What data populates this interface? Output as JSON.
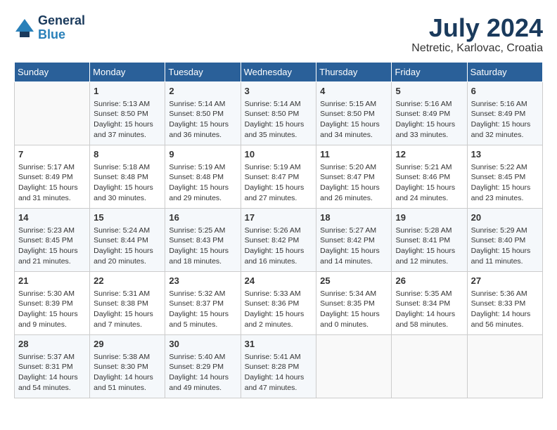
{
  "logo": {
    "line1": "General",
    "line2": "Blue"
  },
  "title": "July 2024",
  "location": "Netretic, Karlovac, Croatia",
  "headers": [
    "Sunday",
    "Monday",
    "Tuesday",
    "Wednesday",
    "Thursday",
    "Friday",
    "Saturday"
  ],
  "weeks": [
    [
      {
        "day": "",
        "data": ""
      },
      {
        "day": "1",
        "data": "Sunrise: 5:13 AM\nSunset: 8:50 PM\nDaylight: 15 hours and 37 minutes."
      },
      {
        "day": "2",
        "data": "Sunrise: 5:14 AM\nSunset: 8:50 PM\nDaylight: 15 hours and 36 minutes."
      },
      {
        "day": "3",
        "data": "Sunrise: 5:14 AM\nSunset: 8:50 PM\nDaylight: 15 hours and 35 minutes."
      },
      {
        "day": "4",
        "data": "Sunrise: 5:15 AM\nSunset: 8:50 PM\nDaylight: 15 hours and 34 minutes."
      },
      {
        "day": "5",
        "data": "Sunrise: 5:16 AM\nSunset: 8:49 PM\nDaylight: 15 hours and 33 minutes."
      },
      {
        "day": "6",
        "data": "Sunrise: 5:16 AM\nSunset: 8:49 PM\nDaylight: 15 hours and 32 minutes."
      }
    ],
    [
      {
        "day": "7",
        "data": "Sunrise: 5:17 AM\nSunset: 8:49 PM\nDaylight: 15 hours and 31 minutes."
      },
      {
        "day": "8",
        "data": "Sunrise: 5:18 AM\nSunset: 8:48 PM\nDaylight: 15 hours and 30 minutes."
      },
      {
        "day": "9",
        "data": "Sunrise: 5:19 AM\nSunset: 8:48 PM\nDaylight: 15 hours and 29 minutes."
      },
      {
        "day": "10",
        "data": "Sunrise: 5:19 AM\nSunset: 8:47 PM\nDaylight: 15 hours and 27 minutes."
      },
      {
        "day": "11",
        "data": "Sunrise: 5:20 AM\nSunset: 8:47 PM\nDaylight: 15 hours and 26 minutes."
      },
      {
        "day": "12",
        "data": "Sunrise: 5:21 AM\nSunset: 8:46 PM\nDaylight: 15 hours and 24 minutes."
      },
      {
        "day": "13",
        "data": "Sunrise: 5:22 AM\nSunset: 8:45 PM\nDaylight: 15 hours and 23 minutes."
      }
    ],
    [
      {
        "day": "14",
        "data": "Sunrise: 5:23 AM\nSunset: 8:45 PM\nDaylight: 15 hours and 21 minutes."
      },
      {
        "day": "15",
        "data": "Sunrise: 5:24 AM\nSunset: 8:44 PM\nDaylight: 15 hours and 20 minutes."
      },
      {
        "day": "16",
        "data": "Sunrise: 5:25 AM\nSunset: 8:43 PM\nDaylight: 15 hours and 18 minutes."
      },
      {
        "day": "17",
        "data": "Sunrise: 5:26 AM\nSunset: 8:42 PM\nDaylight: 15 hours and 16 minutes."
      },
      {
        "day": "18",
        "data": "Sunrise: 5:27 AM\nSunset: 8:42 PM\nDaylight: 15 hours and 14 minutes."
      },
      {
        "day": "19",
        "data": "Sunrise: 5:28 AM\nSunset: 8:41 PM\nDaylight: 15 hours and 12 minutes."
      },
      {
        "day": "20",
        "data": "Sunrise: 5:29 AM\nSunset: 8:40 PM\nDaylight: 15 hours and 11 minutes."
      }
    ],
    [
      {
        "day": "21",
        "data": "Sunrise: 5:30 AM\nSunset: 8:39 PM\nDaylight: 15 hours and 9 minutes."
      },
      {
        "day": "22",
        "data": "Sunrise: 5:31 AM\nSunset: 8:38 PM\nDaylight: 15 hours and 7 minutes."
      },
      {
        "day": "23",
        "data": "Sunrise: 5:32 AM\nSunset: 8:37 PM\nDaylight: 15 hours and 5 minutes."
      },
      {
        "day": "24",
        "data": "Sunrise: 5:33 AM\nSunset: 8:36 PM\nDaylight: 15 hours and 2 minutes."
      },
      {
        "day": "25",
        "data": "Sunrise: 5:34 AM\nSunset: 8:35 PM\nDaylight: 15 hours and 0 minutes."
      },
      {
        "day": "26",
        "data": "Sunrise: 5:35 AM\nSunset: 8:34 PM\nDaylight: 14 hours and 58 minutes."
      },
      {
        "day": "27",
        "data": "Sunrise: 5:36 AM\nSunset: 8:33 PM\nDaylight: 14 hours and 56 minutes."
      }
    ],
    [
      {
        "day": "28",
        "data": "Sunrise: 5:37 AM\nSunset: 8:31 PM\nDaylight: 14 hours and 54 minutes."
      },
      {
        "day": "29",
        "data": "Sunrise: 5:38 AM\nSunset: 8:30 PM\nDaylight: 14 hours and 51 minutes."
      },
      {
        "day": "30",
        "data": "Sunrise: 5:40 AM\nSunset: 8:29 PM\nDaylight: 14 hours and 49 minutes."
      },
      {
        "day": "31",
        "data": "Sunrise: 5:41 AM\nSunset: 8:28 PM\nDaylight: 14 hours and 47 minutes."
      },
      {
        "day": "",
        "data": ""
      },
      {
        "day": "",
        "data": ""
      },
      {
        "day": "",
        "data": ""
      }
    ]
  ]
}
